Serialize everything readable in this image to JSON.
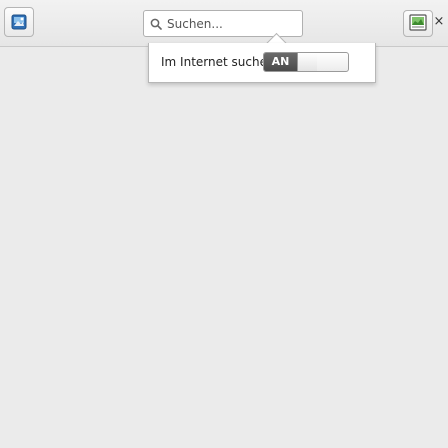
{
  "toolbar": {
    "photo_icon": "photo-icon",
    "search": {
      "placeholder": "Suchen...",
      "icon": "search-icon"
    },
    "frame_icon": "frame-icon",
    "close_label": "×"
  },
  "popup": {
    "label": "Im Internet suchen",
    "toggle": {
      "on_label": "AN",
      "state": "on",
      "accent_color": "#555555"
    }
  }
}
